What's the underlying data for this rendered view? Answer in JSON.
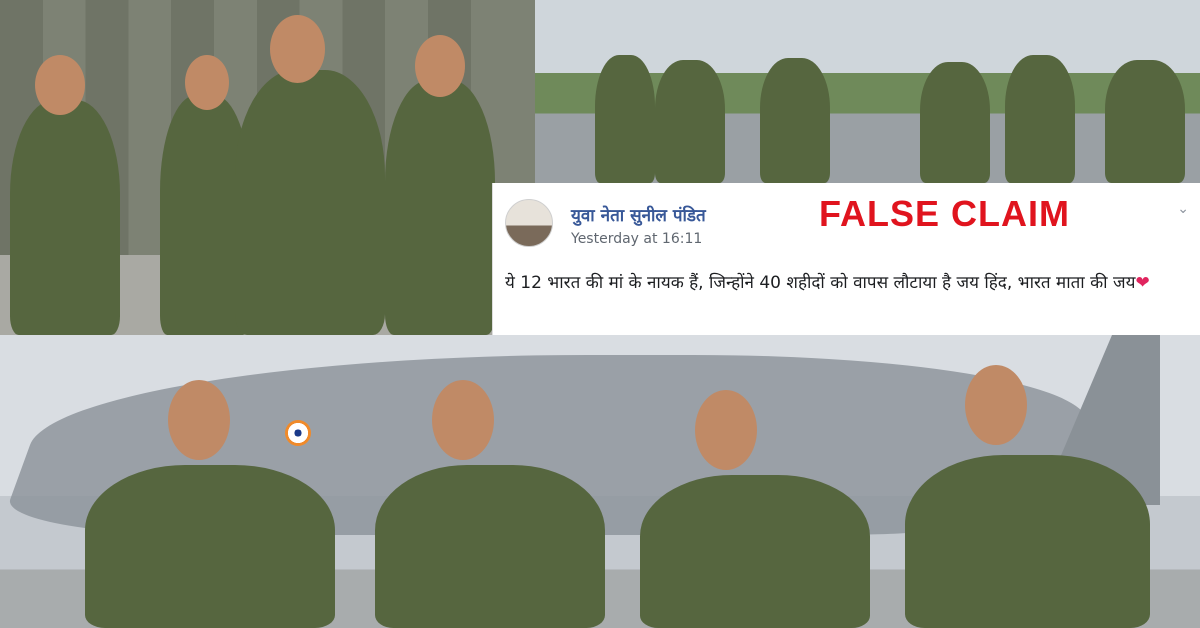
{
  "post": {
    "author": "युवा नेता सुनील पंडित",
    "timestamp": "Yesterday at 16:11",
    "message": "ये 12 भारत की मां के नायक हैं, जिन्होंने 40 शहीदों को वापस लौटाया है जय हिंद, भारत माता की जय",
    "reaction_emoji": "❤",
    "menu_icon": "chevron-down-icon"
  },
  "overlay": {
    "label": "FALSE CLAIM",
    "color": "#e0141e"
  },
  "photos": [
    {
      "subject": "pilots-walking-near-hangar"
    },
    {
      "subject": "pilots-walking-group"
    },
    {
      "subject": "four-pilots-in-front-of-fighter-jet"
    }
  ]
}
